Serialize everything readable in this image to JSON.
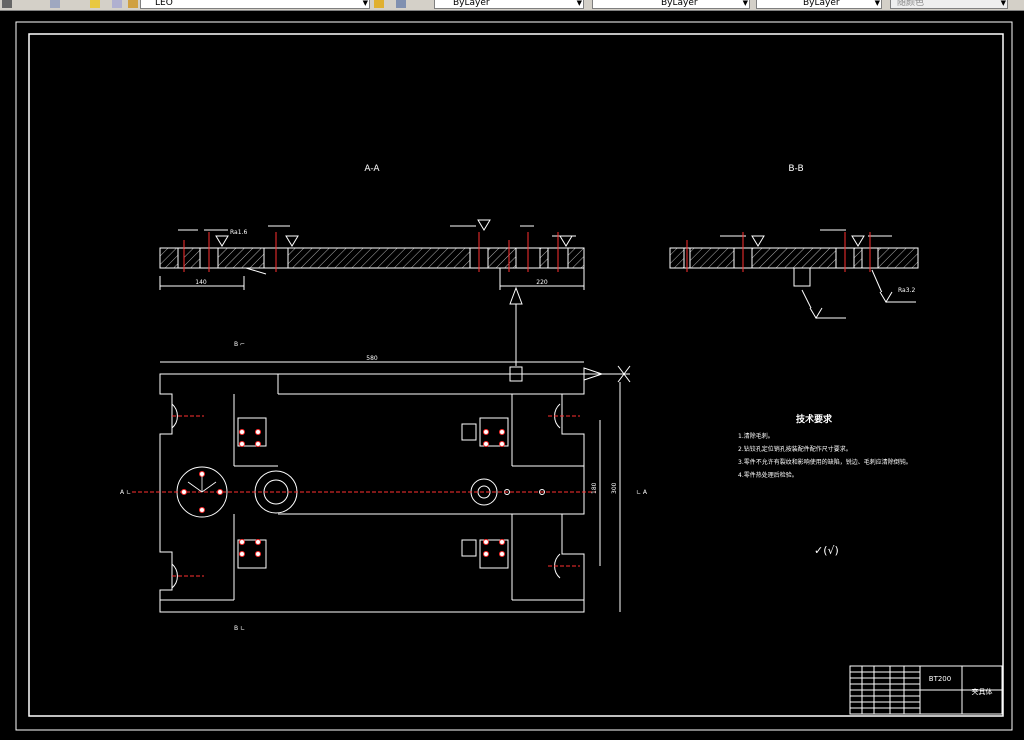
{
  "toolbar": {
    "layer_value": "LEO",
    "color_value": "ByLayer",
    "linetype_value": "ByLayer",
    "lineweight_value": "ByLayer",
    "plotstyle_value": "随颜色"
  },
  "drawing": {
    "section_aa_label": "A-A",
    "section_bb_label": "B-B",
    "tech_req_title": "技术要求",
    "tech_req_lines": [
      "1.清除毛刺。",
      "2.钻铰孔定位销孔按装配件配作尺寸要求。",
      "3.零件不允许有裂纹和影响使用的缺陷，锐边、毛刺应清除倒钝。",
      "4.零件热处理后检验。"
    ],
    "roughness_symbol": "✓(√)",
    "title_block_code": "BT200",
    "title_block_name": "夹具体",
    "dim_overall_length": "580",
    "dim_height_1": "180",
    "dim_height_2": "300",
    "dim_left_bottom": "140",
    "dim_right_bottom": "220",
    "roughness_1": "Ra1.6",
    "roughness_2": "Ra3.2",
    "view_label_a_left": "A ∟",
    "view_label_a_right": "∟ A",
    "view_label_b_top": "B ⌐",
    "view_label_b_bottom": "B ∟"
  },
  "colors": {
    "line": "#ffffff",
    "center": "#ff3030",
    "background": "#000000",
    "toolbar": "#d4d0c8"
  }
}
